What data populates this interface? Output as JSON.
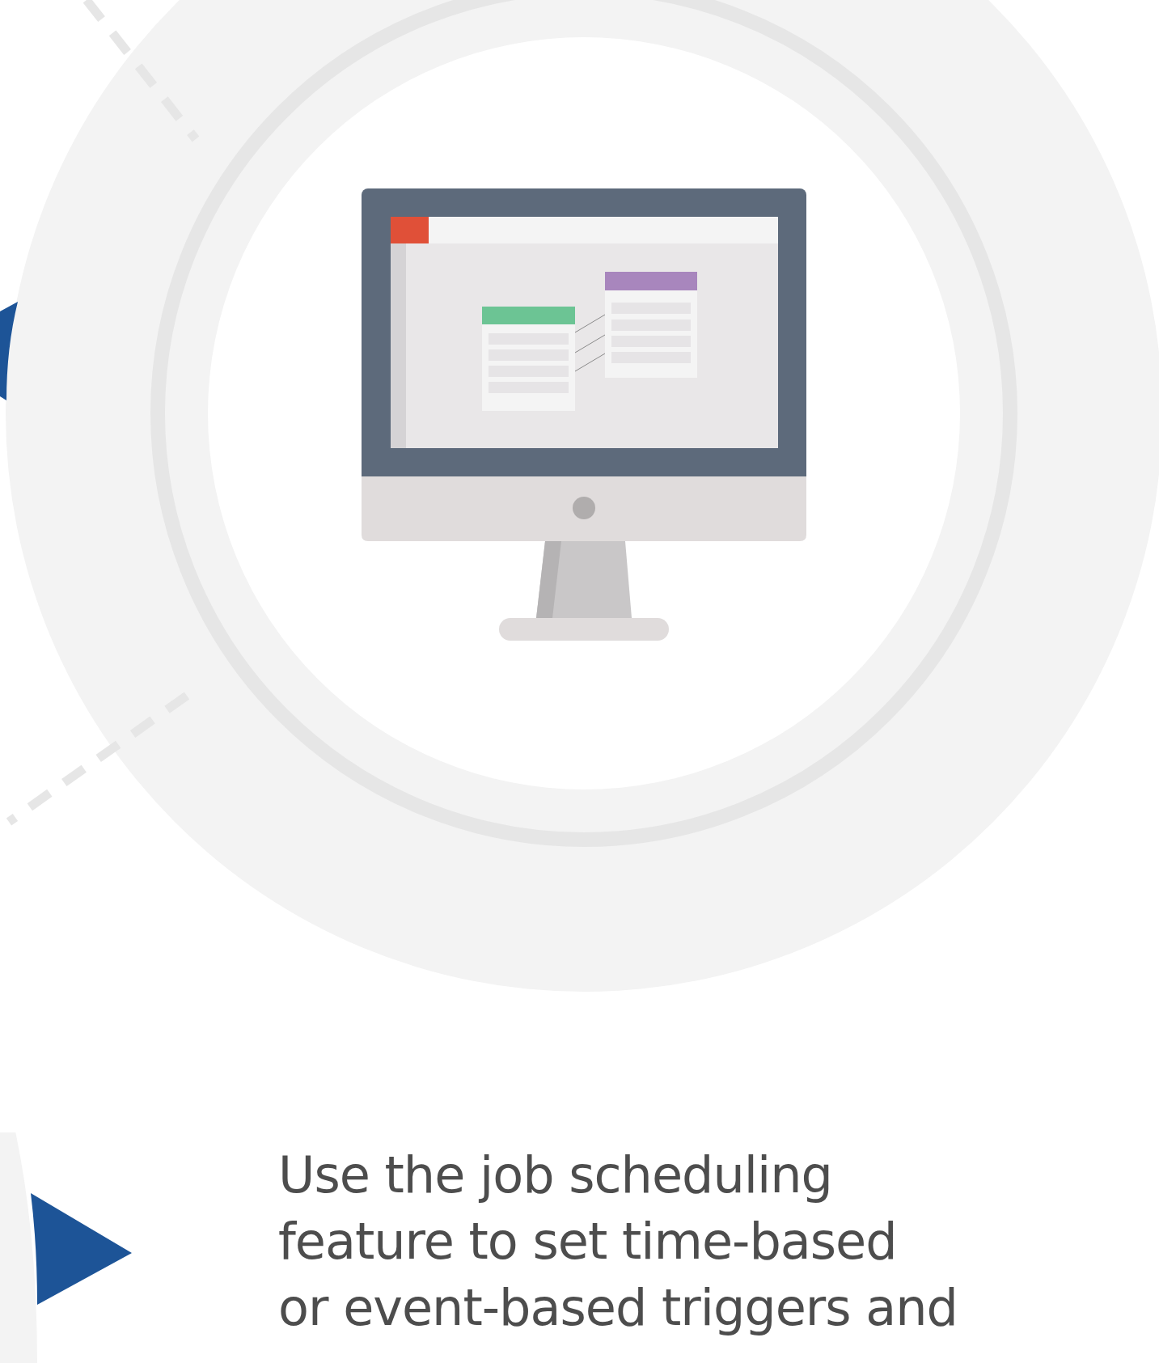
{
  "caption": {
    "lines": [
      "Use the job scheduling",
      "feature to set time-based",
      "or event-based triggers and"
    ]
  }
}
